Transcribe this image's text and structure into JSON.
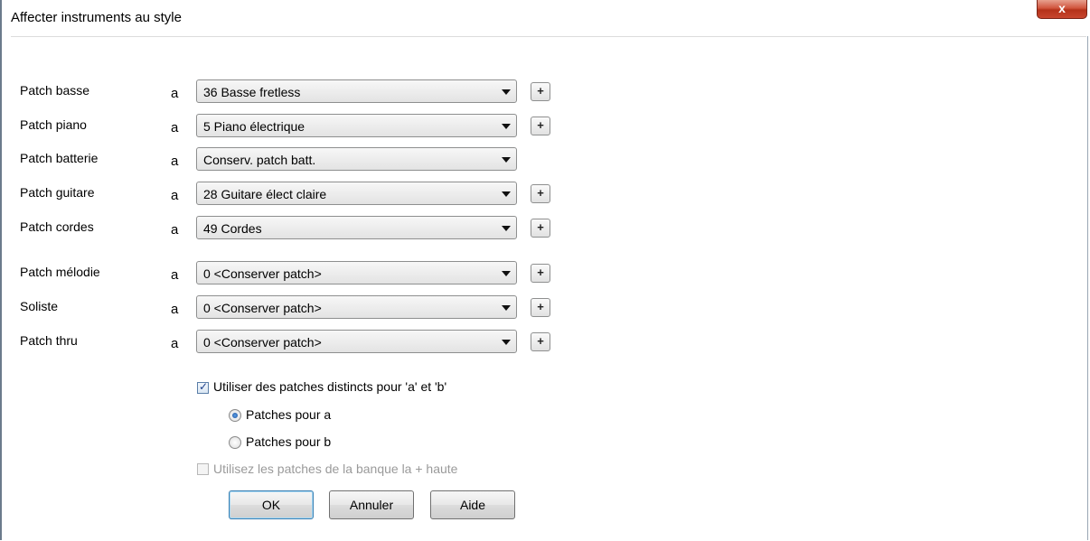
{
  "window": {
    "title": "Affecter instruments au style",
    "close_glyph": "x"
  },
  "rows": [
    {
      "label": "Patch basse",
      "a": "a",
      "value": "36 Basse fretless",
      "plus": "+"
    },
    {
      "label": "Patch piano",
      "a": "a",
      "value": "5 Piano électrique",
      "plus": "+"
    },
    {
      "label": "Patch batterie",
      "a": "a",
      "value": "Conserv. patch batt."
    },
    {
      "label": "Patch guitare",
      "a": "a",
      "value": "28 Guitare élect claire",
      "plus": "+"
    },
    {
      "label": "Patch cordes",
      "a": "a",
      "value": "49 Cordes",
      "plus": "+"
    },
    {
      "label": "Patch mélodie",
      "a": "a",
      "value": "0 <Conserver patch>",
      "plus": "+"
    },
    {
      "label": "Soliste",
      "a": "a",
      "value": "0 <Conserver patch>",
      "plus": "+"
    },
    {
      "label": "Patch thru",
      "a": "a",
      "value": "0 <Conserver patch>",
      "plus": "+"
    }
  ],
  "options": {
    "distinct_patches": {
      "label": "Utiliser des patches distincts pour 'a' et 'b'",
      "checked": true
    },
    "radio_a": {
      "label": "Patches pour a",
      "selected": true
    },
    "radio_b": {
      "label": "Patches pour b",
      "selected": false
    },
    "high_bank": {
      "label": "Utilisez les patches de la banque la + haute",
      "checked": false,
      "disabled": true
    }
  },
  "buttons": {
    "ok": "OK",
    "cancel": "Annuler",
    "help": "Aide"
  },
  "colors": {
    "close_button": "#c8452d",
    "radio_dot": "#1e4f9b",
    "check_mark": "#1d3f8a"
  }
}
